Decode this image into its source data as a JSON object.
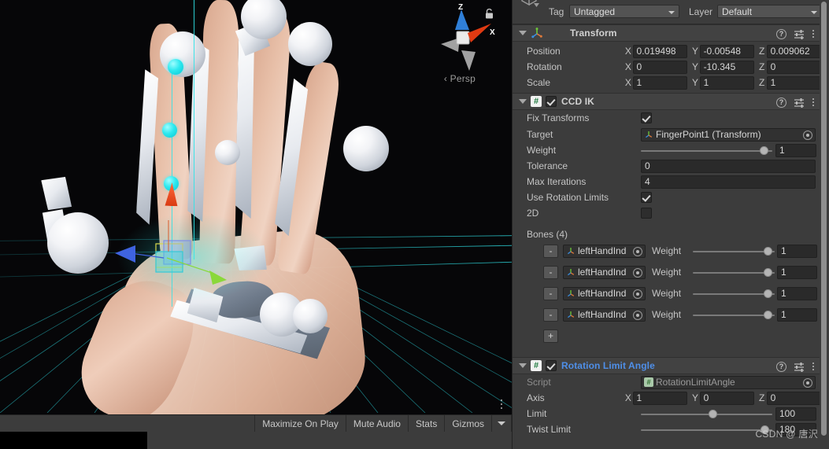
{
  "scene": {
    "gizmo": {
      "x_label": "X",
      "z_label": "Z",
      "projection_label": "Persp",
      "lock_icon": "lock-icon"
    },
    "toolbar": {
      "maximize_on_play": "Maximize On Play",
      "mute_audio": "Mute Audio",
      "stats": "Stats",
      "gizmos": "Gizmos"
    }
  },
  "inspector": {
    "tag": {
      "label": "Tag",
      "value": "Untagged"
    },
    "layer": {
      "label": "Layer",
      "value": "Default"
    },
    "components": [
      {
        "name": "Transform",
        "icon": "transform-axis-icon",
        "enabled": null,
        "rows": [
          {
            "label": "Position",
            "axes": [
              "X",
              "Y",
              "Z"
            ],
            "values": [
              "0.019498",
              "-0.00548",
              "0.009062"
            ]
          },
          {
            "label": "Rotation",
            "axes": [
              "X",
              "Y",
              "Z"
            ],
            "values": [
              "0",
              "-10.345",
              "0"
            ]
          },
          {
            "label": "Scale",
            "axes": [
              "X",
              "Y",
              "Z"
            ],
            "values": [
              "1",
              "1",
              "1"
            ]
          }
        ]
      },
      {
        "name": "CCD IK",
        "icon": "csharp-script-icon",
        "enabled": true,
        "fix_transforms": {
          "label": "Fix Transforms",
          "checked": true
        },
        "target": {
          "label": "Target",
          "value": "FingerPoint1 (Transform)"
        },
        "weight": {
          "label": "Weight",
          "value": "1",
          "fraction": 1
        },
        "tolerance": {
          "label": "Tolerance",
          "value": "0"
        },
        "max_iterations": {
          "label": "Max Iterations",
          "value": "4"
        },
        "use_rotation_limits": {
          "label": "Use Rotation Limits",
          "checked": true
        },
        "two_d": {
          "label": "2D",
          "checked": false
        },
        "bones_label": "Bones (4)",
        "bones": [
          {
            "remove": "-",
            "name": "leftHandInd",
            "weight_label": "Weight",
            "weight": "1",
            "fraction": 1
          },
          {
            "remove": "-",
            "name": "leftHandInd",
            "weight_label": "Weight",
            "weight": "1",
            "fraction": 1
          },
          {
            "remove": "-",
            "name": "leftHandInd",
            "weight_label": "Weight",
            "weight": "1",
            "fraction": 1
          },
          {
            "remove": "-",
            "name": "leftHandInd",
            "weight_label": "Weight",
            "weight": "1",
            "fraction": 1
          }
        ],
        "add_button": "+"
      },
      {
        "name": "Rotation Limit Angle",
        "icon": "csharp-script-icon",
        "enabled": true,
        "script": {
          "label": "Script",
          "value": "RotationLimitAngle"
        },
        "axis": {
          "label": "Axis",
          "axes": [
            "X",
            "Y",
            "Z"
          ],
          "values": [
            "1",
            "0",
            "0"
          ]
        },
        "limit": {
          "label": "Limit",
          "value": "100",
          "fraction": 0.55
        },
        "twist_limit": {
          "label": "Twist Limit",
          "value": "180",
          "fraction": 0.98
        }
      }
    ]
  },
  "watermark": "CSDN @ 唐沢",
  "colors": {
    "panel_bg": "#3c3c3c",
    "header_bg": "#424242",
    "field_bg": "#2a2a2a",
    "text": "#c4c4c4",
    "accent_blue": "#4f8fe8",
    "axis_x_red": "#e03a20",
    "axis_y_green": "#7fd23a",
    "axis_z_blue": "#3a82e0",
    "ik_handle_cyan": "#2ee9ef",
    "scene_bg": "#060608"
  }
}
